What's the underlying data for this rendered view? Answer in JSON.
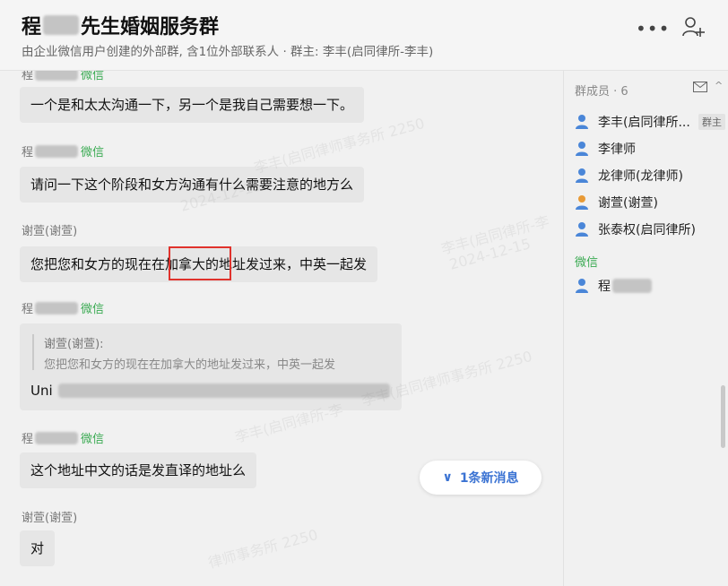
{
  "header": {
    "title_prefix": "程",
    "title_suffix": "先生婚姻服务群",
    "subtitle": "由企业微信用户创建的外部群, 含1位外部联系人 · 群主: 李丰(启同律所-李丰)",
    "more_label": "•••"
  },
  "chat": {
    "messages": [
      {
        "sender": "程",
        "source": "微信",
        "text": "一个是和太太沟通一下，另一个是我自己需要想一下。"
      },
      {
        "sender": "程",
        "source": "微信",
        "text": "请问一下这个阶段和女方沟通有什么需要注意的地方么"
      },
      {
        "sender": "谢萱(谢萱)",
        "text": "您把您和女方的现在在加拿大的地址发过来，中英一起发",
        "highlight": "加拿大"
      },
      {
        "sender": "程",
        "source": "微信",
        "quote_author": "谢萱(谢萱):",
        "quote_text": "您把您和女方的现在在加拿大的地址发过来，中英一起发",
        "text": "Uni"
      },
      {
        "sender": "程",
        "source": "微信",
        "text": "这个地址中文的话是发直译的地址么"
      },
      {
        "sender": "谢萱(谢萱)",
        "text": "对"
      }
    ],
    "new_messages_label": "1条新消息"
  },
  "members": {
    "header": "群成员 · 6",
    "collapse": "^",
    "owner_badge": "群主",
    "list": [
      {
        "name": "李丰(启同律所...",
        "icon": "person-blue-icon"
      },
      {
        "name": "李律师",
        "icon": "person-blue-icon"
      },
      {
        "name": "龙律师(龙律师)",
        "icon": "person-blue-icon"
      },
      {
        "name": "谢萱(谢萱)",
        "icon": "person-orange-icon"
      },
      {
        "name": "张泰权(启同律所)",
        "icon": "person-blue-icon"
      }
    ],
    "wechat_section": "微信",
    "wechat_members": [
      {
        "name": "程",
        "icon": "person-blue-icon"
      }
    ]
  },
  "watermarks": {
    "w1": "李丰(启同律师事务所 2250",
    "w2": "2024-12-15",
    "w3": "李丰(启同律所-李",
    "w4": "律师事务所 2250"
  },
  "colors": {
    "accent_green": "#3aaa52",
    "highlight_red": "#e0322c",
    "link_blue": "#3b73d3"
  }
}
